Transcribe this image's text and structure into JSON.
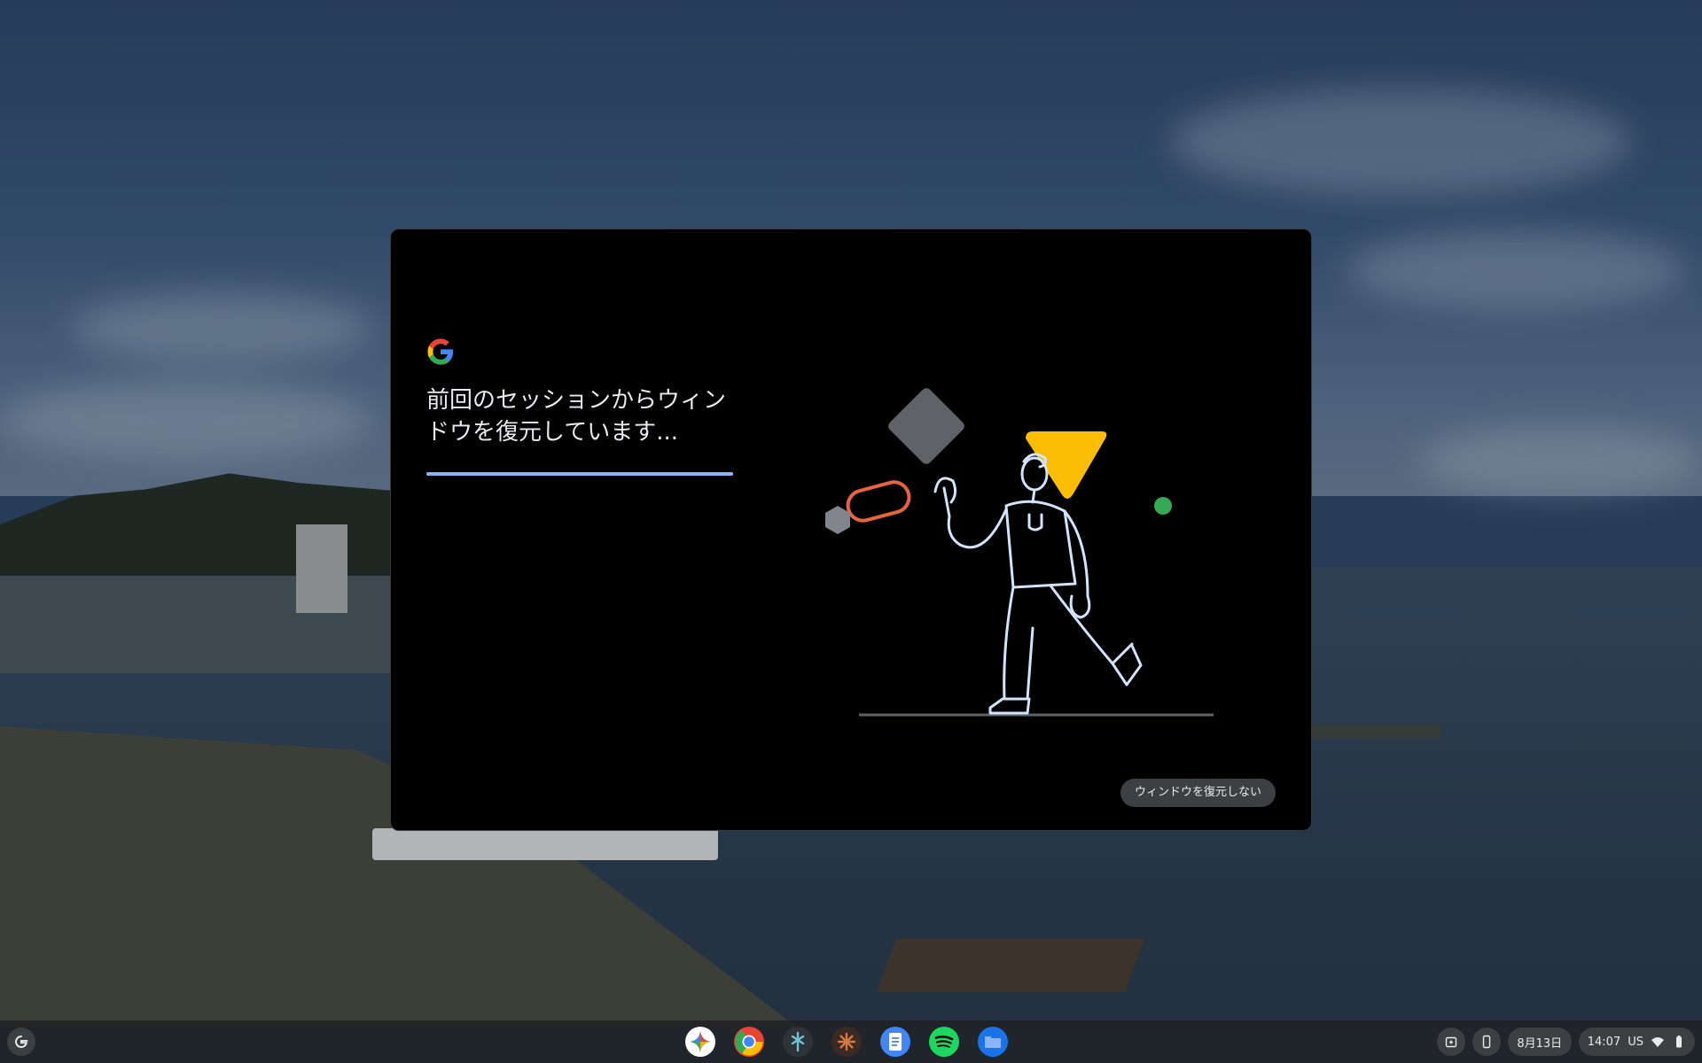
{
  "dialog": {
    "title": "前回のセッションからウィンドウを復元しています...",
    "skip_button": "ウィンドウを復元しない",
    "progress_fraction": 1.0,
    "accent_colors": {
      "progress": "#8ab4f8",
      "triangle": "#fbbc04",
      "capsule": "#e8643c",
      "dot": "#34a853",
      "diamond": "#5f6368"
    }
  },
  "shelf": {
    "launcher_icon": "google-g-icon",
    "apps": [
      {
        "name": "gemini-app-icon"
      },
      {
        "name": "chrome-app-icon"
      },
      {
        "name": "perplexity-app-icon"
      },
      {
        "name": "claude-app-icon"
      },
      {
        "name": "google-docs-app-icon"
      },
      {
        "name": "spotify-app-icon"
      },
      {
        "name": "files-app-icon"
      }
    ],
    "tray": {
      "date": "8月13日",
      "time": "14:07",
      "input_method": "US"
    }
  }
}
